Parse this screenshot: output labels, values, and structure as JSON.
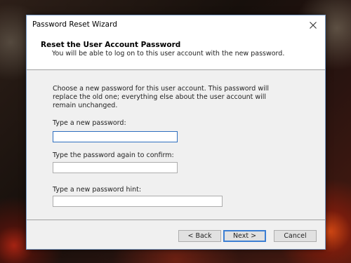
{
  "window": {
    "title": "Password Reset Wizard"
  },
  "header": {
    "title": "Reset the User Account Password",
    "subtitle": "You will be able to log on to this user account with the new password."
  },
  "main": {
    "description": "Choose a new password for this user account. This password will replace the old one; everything else about the user account will remain unchanged.",
    "fields": [
      {
        "label": "Type a new password:",
        "value": "",
        "placeholder": ""
      },
      {
        "label": "Type the password again to confirm:",
        "value": "",
        "placeholder": ""
      },
      {
        "label": "Type a new password hint:",
        "value": "",
        "placeholder": ""
      }
    ]
  },
  "buttons": {
    "back": "< Back",
    "next": "Next >",
    "cancel": "Cancel"
  },
  "icons": {
    "close": "close-icon"
  },
  "colors": {
    "focus_border": "#2f6fbf",
    "default_button_border": "#3c7fd3"
  }
}
